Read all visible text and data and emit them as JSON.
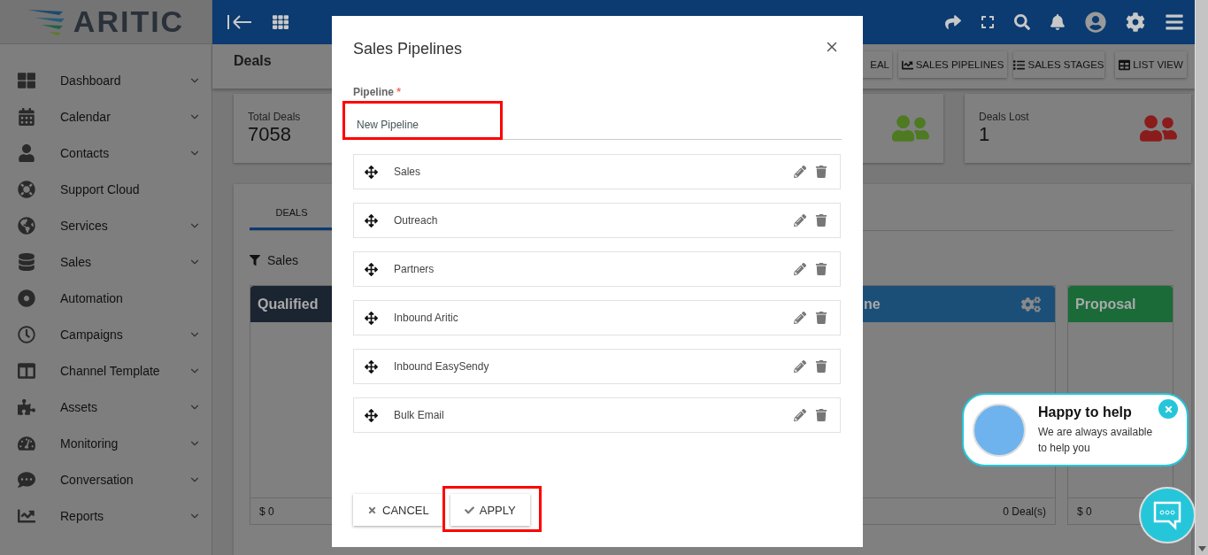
{
  "sidebar": {
    "logo": "ARITIC",
    "items": [
      {
        "label": "Dashboard",
        "expandable": true
      },
      {
        "label": "Calendar",
        "expandable": true
      },
      {
        "label": "Contacts",
        "expandable": true
      },
      {
        "label": "Support Cloud",
        "expandable": false
      },
      {
        "label": "Services",
        "expandable": true
      },
      {
        "label": "Sales",
        "expandable": true
      },
      {
        "label": "Automation",
        "expandable": false
      },
      {
        "label": "Campaigns",
        "expandable": true
      },
      {
        "label": "Channel Template",
        "expandable": true
      },
      {
        "label": "Assets",
        "expandable": true
      },
      {
        "label": "Monitoring",
        "expandable": true
      },
      {
        "label": "Conversation",
        "expandable": true
      },
      {
        "label": "Reports",
        "expandable": true
      }
    ]
  },
  "page": {
    "title": "Deals",
    "actions": [
      {
        "label": "EAL"
      },
      {
        "label": "SALES PIPELINES"
      },
      {
        "label": "SALES STAGES"
      },
      {
        "label": "LIST VIEW"
      }
    ]
  },
  "stats": [
    {
      "label": "Total Deals",
      "value": "7058"
    },
    {
      "color": "#4e7a22"
    },
    {
      "label": "Deals Lost",
      "value": "1",
      "color": "#8a1c1c"
    }
  ],
  "tabs": [
    {
      "label": "DEALS",
      "selected": true
    }
  ],
  "filter": "Sales",
  "stages": [
    {
      "name": "Qualified",
      "color": "#1b2531",
      "footer": "$ 0"
    },
    {
      "name": "ne",
      "color": "#1c4f78",
      "footer": "0 Deal(s)",
      "settings": true
    },
    {
      "name": "Proposal",
      "color": "#1a6b38",
      "footer": "$ 0",
      "settings": false
    }
  ],
  "modal": {
    "title": "Sales Pipelines",
    "field": {
      "label": "Pipeline",
      "required_mark": "*",
      "value": "New Pipeline",
      "highlighted": true
    },
    "pipelines": [
      "Sales",
      "Outreach",
      "Partners",
      "Inbound Aritic",
      "Inbound EasySendy",
      "Bulk Email"
    ],
    "buttons": [
      {
        "label": "CANCEL",
        "kind": "cancel",
        "highlighted": false
      },
      {
        "label": "APPLY",
        "kind": "apply",
        "highlighted": true
      }
    ]
  },
  "chat": {
    "title": "Happy to help",
    "message": "We are always available to help you"
  }
}
